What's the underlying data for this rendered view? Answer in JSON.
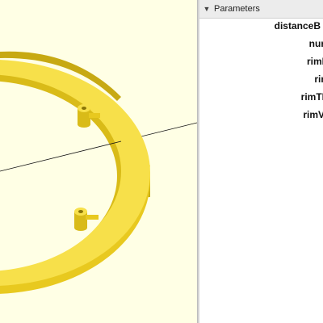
{
  "parameters_panel": {
    "title": "Parameters",
    "collapse_icon": "triangle-down-icon",
    "items": [
      {
        "label": "distanceB"
      },
      {
        "label": "nur"
      },
      {
        "label": "rimI"
      },
      {
        "label": "rir"
      },
      {
        "label": "rimTI"
      },
      {
        "label": "rimV"
      }
    ]
  },
  "viewport": {
    "background_color": "#ffffe5",
    "model_color": "#f5dc3a"
  }
}
